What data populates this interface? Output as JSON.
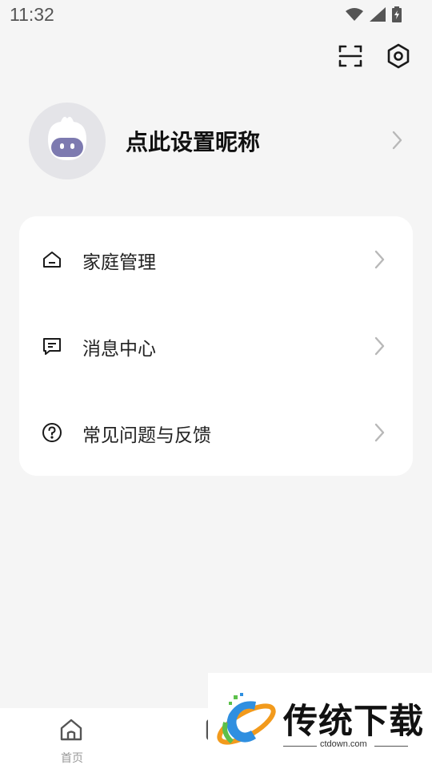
{
  "status_bar": {
    "time": "11:32"
  },
  "header": {
    "scan_icon": "scan-icon",
    "settings_icon": "settings-icon"
  },
  "profile": {
    "nickname": "点此设置昵称"
  },
  "menu": {
    "items": [
      {
        "label": "家庭管理",
        "icon": "home-icon"
      },
      {
        "label": "消息中心",
        "icon": "message-icon"
      },
      {
        "label": "常见问题与反馈",
        "icon": "help-icon"
      }
    ]
  },
  "tabbar": {
    "tabs": [
      {
        "label": "首页",
        "icon": "home-tab-icon"
      }
    ]
  },
  "watermark": {
    "title": "传统下载",
    "url": "ctdown.com"
  },
  "colors": {
    "background": "#f5f5f5",
    "card": "#ffffff",
    "chevron": "#b8b8b8"
  }
}
